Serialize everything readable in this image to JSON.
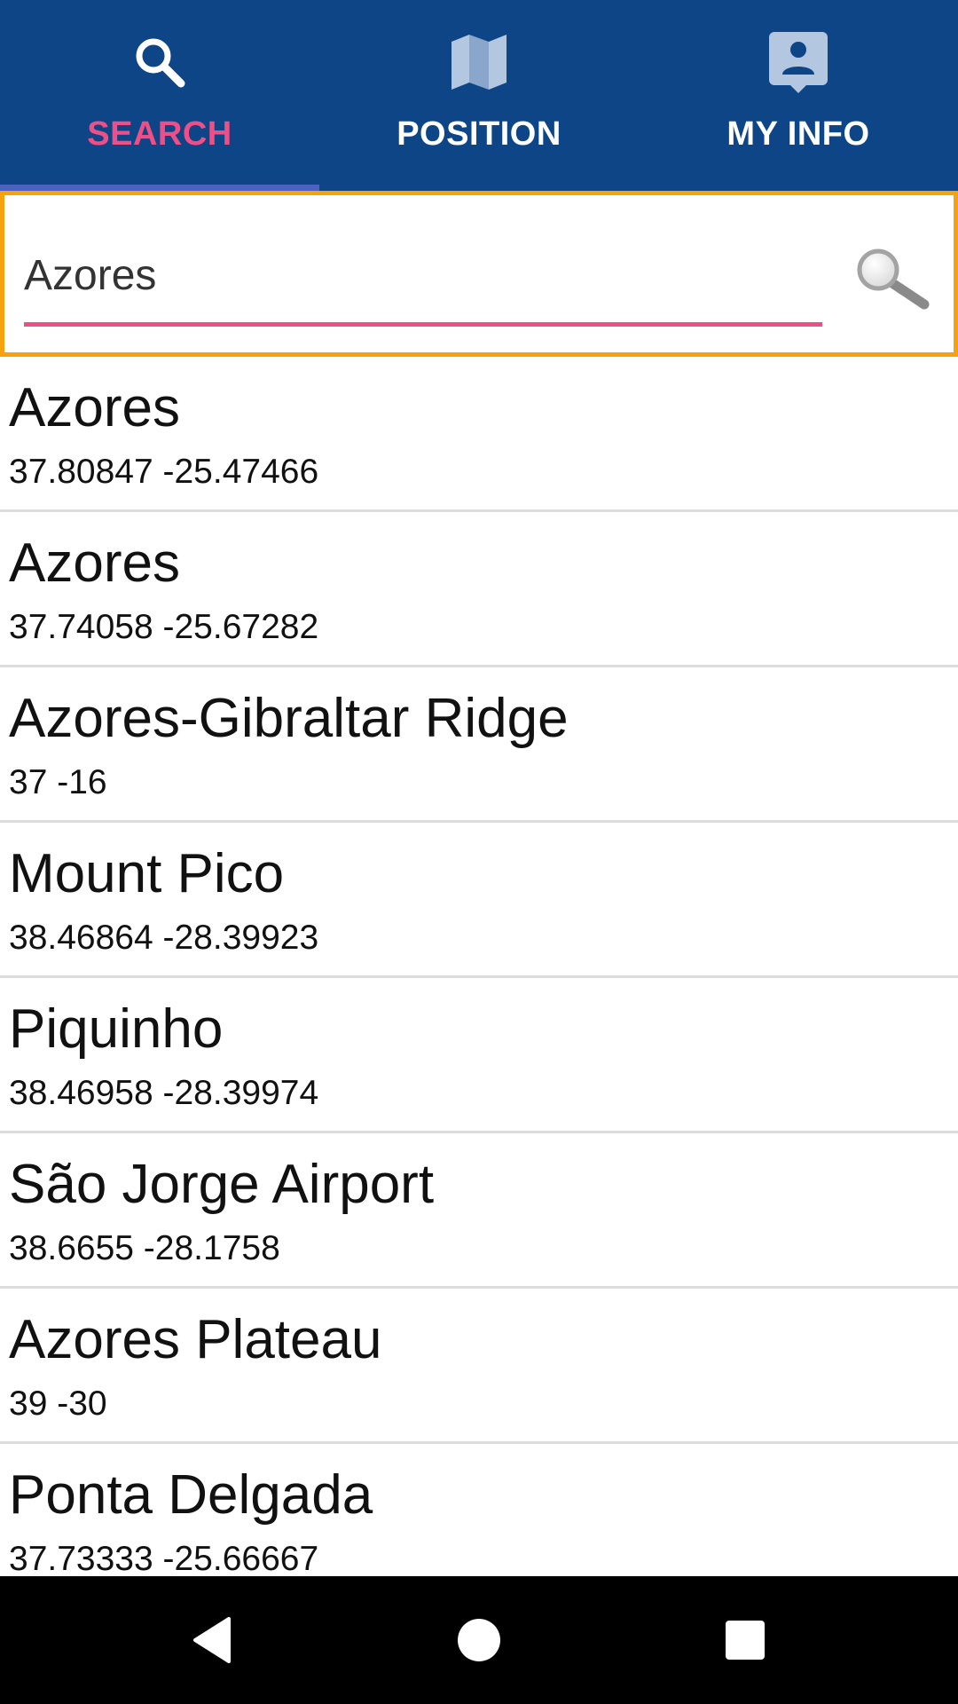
{
  "tabs": [
    {
      "label": "SEARCH",
      "icon": "search-icon",
      "active": true
    },
    {
      "label": "POSITION",
      "icon": "map-icon",
      "active": false
    },
    {
      "label": "MY INFO",
      "icon": "contact-info-icon",
      "active": false
    }
  ],
  "search": {
    "value": "Azores",
    "button_icon": "magnifier-icon"
  },
  "results": [
    {
      "name": "Azores",
      "coords": "37.80847 -25.47466"
    },
    {
      "name": "Azores",
      "coords": "37.74058 -25.67282"
    },
    {
      "name": "Azores-Gibraltar Ridge",
      "coords": "37 -16"
    },
    {
      "name": "Mount Pico",
      "coords": "38.46864 -28.39923"
    },
    {
      "name": "Piquinho",
      "coords": "38.46958 -28.39974"
    },
    {
      "name": "São Jorge Airport",
      "coords": "38.6655 -28.1758"
    },
    {
      "name": "Azores Plateau",
      "coords": "39 -30"
    },
    {
      "name": "Ponta Delgada",
      "coords": "37.73333 -25.66667"
    }
  ],
  "navbar": {
    "back_icon": "back-triangle-icon",
    "home_icon": "home-circle-icon",
    "recents_icon": "recents-square-icon"
  },
  "colors": {
    "tabbar_background": "#0d4587",
    "active_tab_label": "#ef4f86",
    "tab_indicator": "#4c62c2",
    "search_border": "#f6a20f",
    "input_underline": "#ef4f86"
  }
}
